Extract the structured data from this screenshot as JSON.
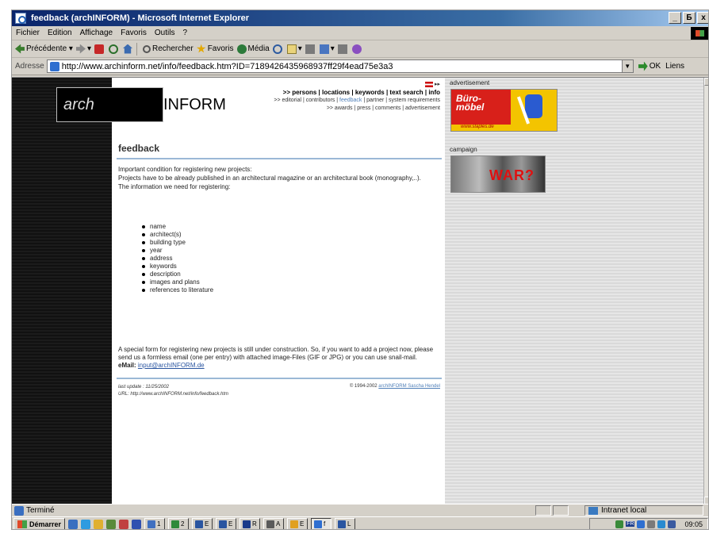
{
  "window": {
    "title": "feedback (archINFORM) - Microsoft Internet Explorer",
    "minimize": "_",
    "maximize": "Б",
    "close": "x"
  },
  "menu": [
    "Fichier",
    "Edition",
    "Affichage",
    "Favoris",
    "Outils",
    "?"
  ],
  "toolbar": {
    "back": "Précédente",
    "search": "Rechercher",
    "favorites": "Favoris",
    "media": "Média"
  },
  "address": {
    "label": "Adresse",
    "url": "http://www.archinform.net/info/feedback.htm?ID=7189426435968937ff29f4ead75e3a3",
    "go": "OK",
    "links": "Liens"
  },
  "page": {
    "logo_italic": "arch",
    "logo_bold": "INFORM",
    "nav_row1": ">> persons | locations | keywords | text search | info",
    "nav_row2_pre": ">> editorial | contributors | ",
    "nav_row2_active": "feedback",
    "nav_row2_post": " | partner | system requirements",
    "nav_row3": ">> awards | press | comments | advertisement",
    "heading": "feedback",
    "intro_line1": "Important condition for registering new projects:",
    "intro_line2": "Projects have to be already published in an architectural magazine or an architectural book (monography,..).",
    "intro_line3": "The information we need for registering:",
    "fields": [
      "name",
      "architect(s)",
      "building type",
      "year",
      "address",
      "keywords",
      "description",
      "images and plans",
      "references to literature"
    ],
    "outro": "A special form for registering new projects is still under construction. So, if you want to add a project now, please send us a formless email (one per entry) with attached image-Files (GIF or JPG) or you can use snail-mail.",
    "email_label": "eMail:",
    "email": "input@archINFORM.de",
    "last_update": "last update : 11/25/2002",
    "page_url": "URL: http://www.archINFORM.net/info/feedback.htm",
    "copyright": "© 1994-2002",
    "copyright_links": "archINFORM Sascha Hendel"
  },
  "sidebar": {
    "ad_label": "advertisement",
    "ad_text1": "Büro-",
    "ad_text2": "möbel",
    "ad_url": "www.staples.de",
    "campaign_label": "campaign",
    "campaign_text": "WAR?"
  },
  "status": {
    "text": "Terminé",
    "zone": "Intranet local"
  },
  "taskbar": {
    "start": "Démarrer",
    "clock": "09:05",
    "tray_lang": "FR",
    "tasks": [
      "1",
      "2",
      "E",
      "E",
      "R",
      "A",
      "E",
      "f",
      "L"
    ]
  },
  "colors": {
    "titlebar": "#0a246a",
    "link": "#4f7fb8",
    "rule": "#9bb8d6",
    "ad_red": "#d8201a"
  }
}
